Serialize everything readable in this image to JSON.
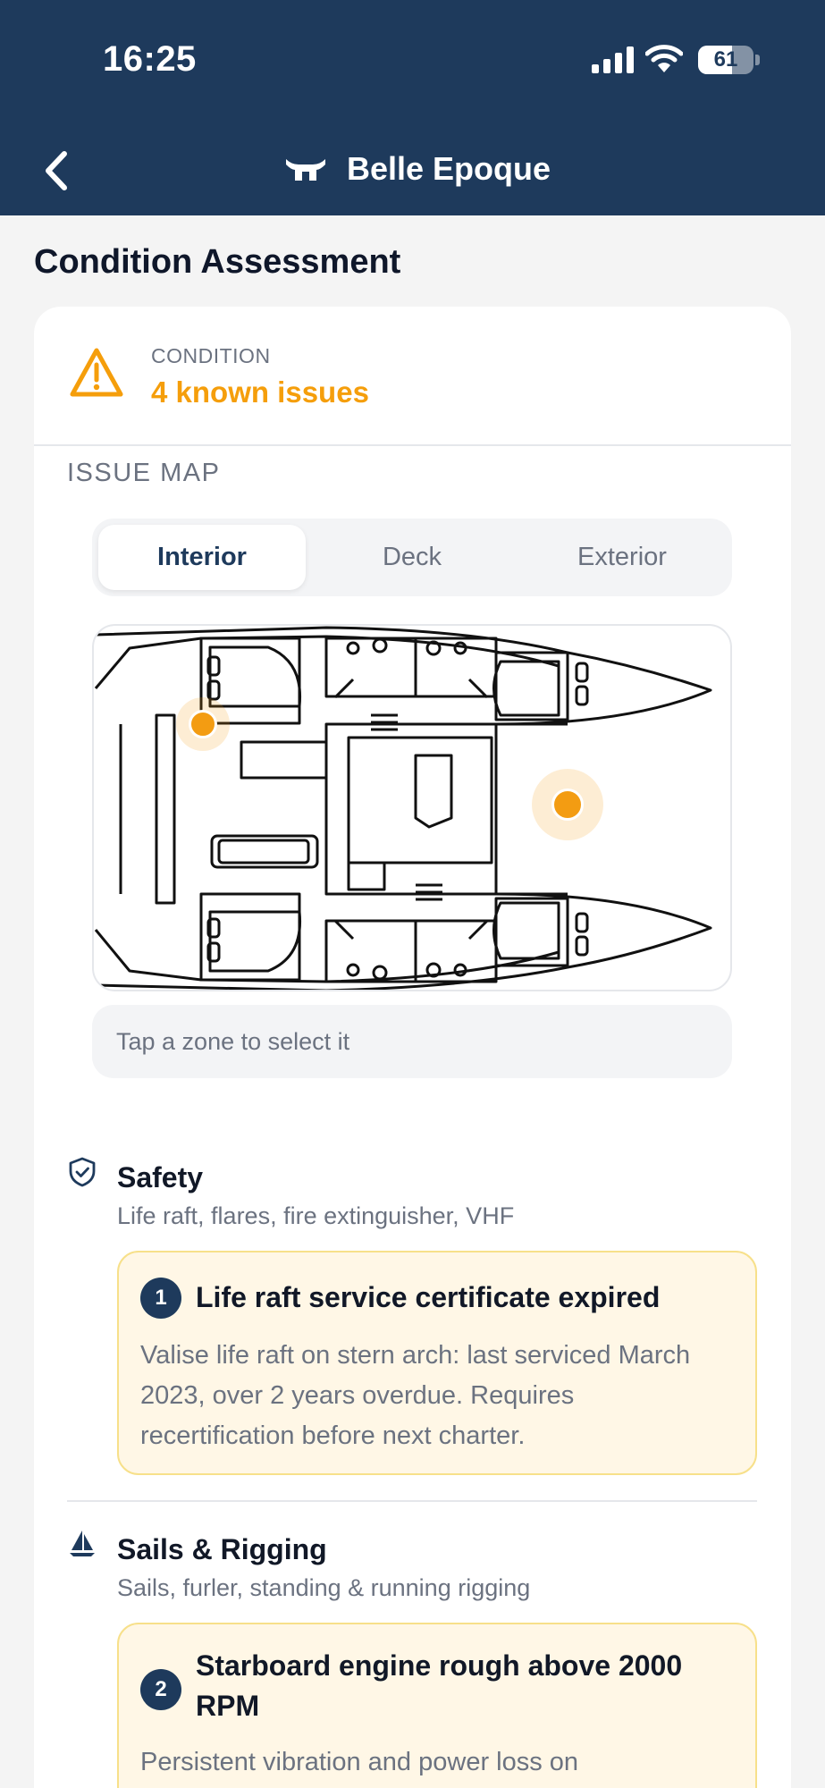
{
  "status_bar": {
    "time": "16:25",
    "battery": "61",
    "battery_level": 0.61
  },
  "nav": {
    "title": "Belle Epoque"
  },
  "page": {
    "title": "Condition Assessment"
  },
  "condition": {
    "label": "CONDITION",
    "value": "4 known issues"
  },
  "issue_map": {
    "label": "ISSUE MAP",
    "tabs": [
      {
        "label": "Interior",
        "active": true
      },
      {
        "label": "Deck",
        "active": false
      },
      {
        "label": "Exterior",
        "active": false
      }
    ],
    "hint": "Tap a zone to select it"
  },
  "categories": [
    {
      "title": "Safety",
      "subtitle": "Life raft, flares, fire extinguisher, VHF",
      "icon": "shield-check-icon",
      "issue": {
        "number": "1",
        "title": "Life raft service certificate expired",
        "description": "Valise life raft on stern arch: last serviced March 2023, over 2 years overdue. Requires recertification before next charter."
      }
    },
    {
      "title": "Sails & Rigging",
      "subtitle": "Sails, furler, standing & running rigging",
      "icon": "sailboat-icon",
      "issue": {
        "number": "2",
        "title": "Starboard engine rough above 2000 RPM",
        "description": "Persistent vibration and power loss on"
      }
    }
  ],
  "colors": {
    "navy": "#1e3a5c",
    "warning": "#f59e0b",
    "issue_bg": "#fff7e6",
    "issue_border": "#f7e08a",
    "marker": "#f39c12"
  }
}
